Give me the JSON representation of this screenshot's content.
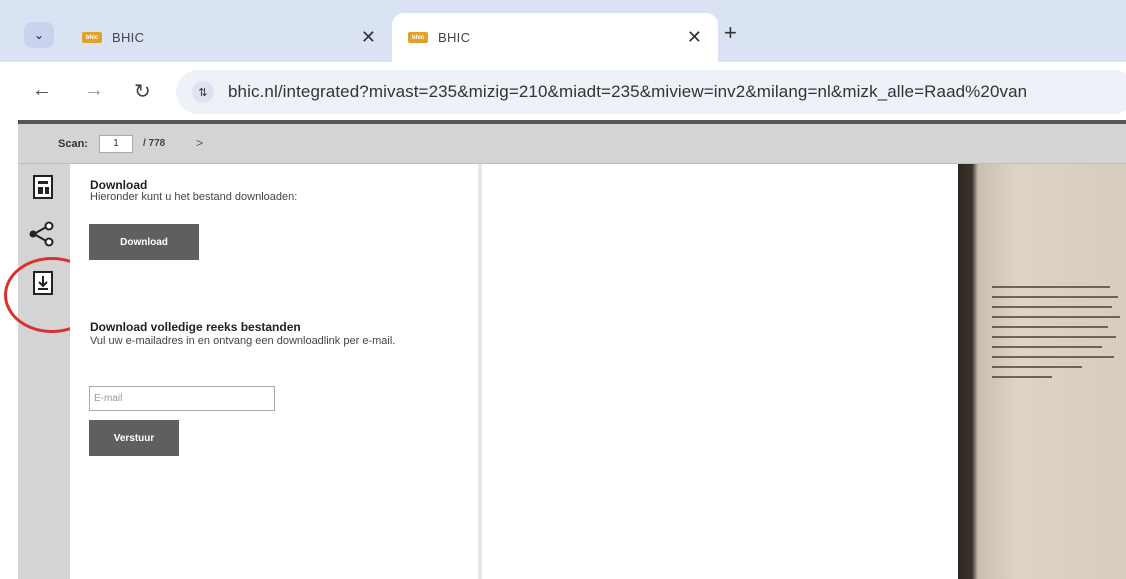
{
  "browser": {
    "tabs": [
      {
        "title": "BHIC",
        "favicon": "bhic-favicon",
        "active": false
      },
      {
        "title": "BHIC",
        "favicon": "bhic-favicon",
        "active": true
      }
    ],
    "new_tab": "+",
    "url": "bhic.nl/integrated?mivast=235&mizig=210&miadt=235&miview=inv2&milang=nl&mizk_alle=Raad%20van"
  },
  "scanbar": {
    "label": "Scan:",
    "current": "1",
    "total": "/ 778",
    "next": ">"
  },
  "panel": {
    "download_heading": "Download",
    "download_text": "Hieronder kunt u het bestand downloaden:",
    "download_button": "Download",
    "series_heading": "Download volledige reeks bestanden",
    "series_text": "Vul uw e-mailadres in en ontvang een downloadlink per e-mail.",
    "email_placeholder": "E-mail",
    "send_button": "Verstuur"
  },
  "colors": {
    "highlight_circle": "#d9312f",
    "button": "#5f5f5f",
    "favicon": "#e2a227"
  }
}
